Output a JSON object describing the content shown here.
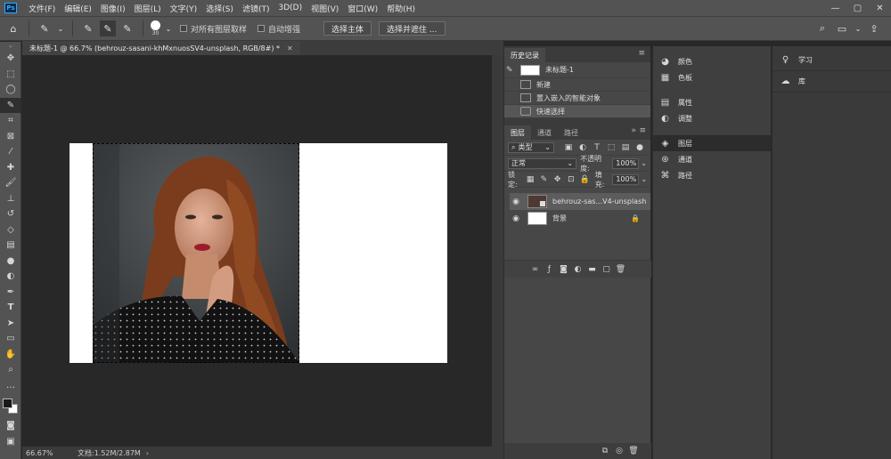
{
  "app": {
    "logo": "Ps",
    "menus": [
      "文件(F)",
      "编辑(E)",
      "图像(I)",
      "图层(L)",
      "文字(Y)",
      "选择(S)",
      "滤镜(T)",
      "3D(D)",
      "视图(V)",
      "窗口(W)",
      "帮助(H)"
    ],
    "window_controls": [
      "—",
      "▢",
      "✕"
    ]
  },
  "options": {
    "brush_size": "30",
    "sample_all_layers": "对所有图层取样",
    "auto_enhance": "自动增强",
    "select_subject": "选择主体",
    "select_and_mask": "选择并遮住 ..."
  },
  "document": {
    "tab_title": "未标题-1 @ 66.7% (behrouz-sasani-khMxnuosSV4-unsplash, RGB/8#) *",
    "zoom": "66.67%",
    "doc_info": "文档:1.52M/2.87M"
  },
  "history": {
    "title": "历史记录",
    "snapshot": "未标题-1",
    "items": [
      "新建",
      "置入嵌入的智能对象",
      "快速选择"
    ]
  },
  "layers": {
    "tabs": [
      "图层",
      "通道",
      "路径"
    ],
    "filter_kind": "类型",
    "blend_mode": "正常",
    "opacity_label": "不透明度:",
    "opacity_value": "100%",
    "lock_label": "锁定:",
    "fill_label": "填充:",
    "fill_value": "100%",
    "items": [
      {
        "name": "behrouz-sas...V4-unsplash"
      },
      {
        "name": "背景"
      }
    ]
  },
  "panel2": {
    "items": [
      "颜色",
      "色板",
      "属性",
      "调整",
      "图层",
      "通道",
      "路径"
    ]
  },
  "panel3": {
    "items": [
      "学习",
      "库"
    ]
  }
}
